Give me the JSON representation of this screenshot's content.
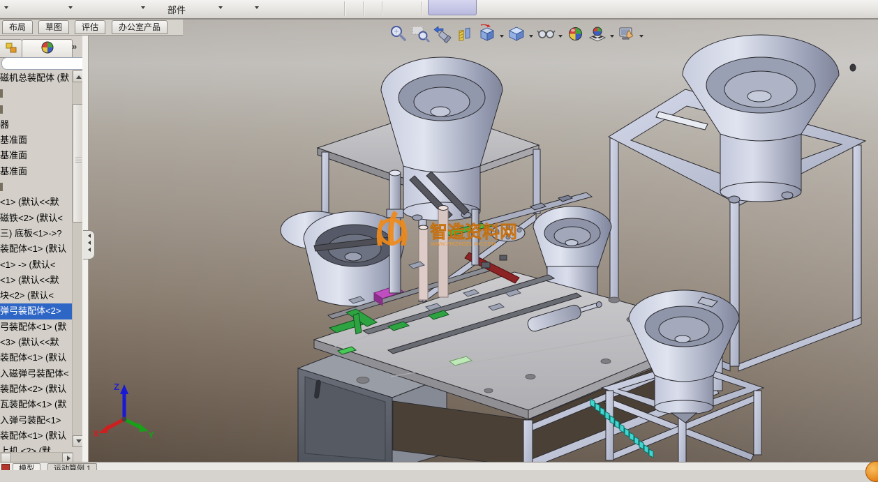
{
  "app": {
    "name": "SolidWorks assembly window (cropped)",
    "selection_color": "#2e66c6"
  },
  "top_toolbar": {
    "component_label": "部件",
    "dropdown_buttons": [
      "collapsed-dropdown-1",
      "collapsed-dropdown-2",
      "collapsed-dropdown-3",
      "component-dropdown-1",
      "component-dropdown-2"
    ],
    "active_button": "pressed-toolbar-button"
  },
  "command_tabs": [
    {
      "label": "布局"
    },
    {
      "label": "草图"
    },
    {
      "label": "评估"
    },
    {
      "label": "办公室产品"
    }
  ],
  "panel": {
    "tabs": [
      {
        "name": "feature-manager-tab"
      },
      {
        "name": "display-manager-tab"
      }
    ],
    "overflow_chevron": "»",
    "filter_value": "",
    "tree": [
      {
        "label": "磁机总装配体 (默",
        "selected": false
      },
      {
        "label": "",
        "selected": false
      },
      {
        "label": "",
        "selected": false
      },
      {
        "label": "器",
        "selected": false
      },
      {
        "label": "基准面",
        "selected": false
      },
      {
        "label": "基准面",
        "selected": false
      },
      {
        "label": "基准面",
        "selected": false
      },
      {
        "label": "",
        "selected": false
      },
      {
        "label": "<1> (默认<<默",
        "selected": false
      },
      {
        "label": "磁铁<2> (默认<",
        "selected": false
      },
      {
        "label": "三) 底板<1>->?",
        "selected": false
      },
      {
        "label": "装配体<1> (默认",
        "selected": false
      },
      {
        "label": "<1> -> (默认<",
        "selected": false
      },
      {
        "label": "<1> (默认<<默",
        "selected": false
      },
      {
        "label": "块<2> (默认<",
        "selected": false
      },
      {
        "label": "弹弓装配体<2>",
        "selected": true
      },
      {
        "label": "弓装配体<1> (默",
        "selected": false
      },
      {
        "label": "<3> (默认<<默",
        "selected": false
      },
      {
        "label": "装配体<1> (默认",
        "selected": false
      },
      {
        "label": "入磁弹弓装配体<",
        "selected": false
      },
      {
        "label": "装配体<2> (默认",
        "selected": false
      },
      {
        "label": "瓦装配体<1> (默",
        "selected": false
      },
      {
        "label": "入弹弓装配<1>",
        "selected": false
      },
      {
        "label": "装配体<1> (默认",
        "selected": false
      },
      {
        "label": "上机 <2> (默",
        "selected": false
      }
    ]
  },
  "hud_toolbar": {
    "icons": [
      {
        "name": "zoom-to-fit",
        "has_dropdown": false
      },
      {
        "name": "zoom-to-area",
        "has_dropdown": false
      },
      {
        "name": "previous-view",
        "has_dropdown": false
      },
      {
        "name": "section-view",
        "has_dropdown": false
      },
      {
        "name": "view-orientation",
        "has_dropdown": true
      },
      {
        "name": "display-style",
        "has_dropdown": true
      },
      {
        "name": "hide-show-items",
        "has_dropdown": true
      },
      {
        "name": "edit-appearance",
        "has_dropdown": false
      },
      {
        "name": "apply-scene",
        "has_dropdown": true
      },
      {
        "name": "view-settings",
        "has_dropdown": true
      }
    ]
  },
  "viewport": {
    "watermark": {
      "title": "智造资料网",
      "subtext": "WWW.ZHIZAOZILIAO.COM",
      "color": "#ee8816"
    },
    "triad": {
      "x_label": "X",
      "y_label": "Y",
      "z_label": "Z",
      "x_color": "#cc2020",
      "y_color": "#18a018",
      "z_color": "#1818d8"
    },
    "scene_objects": [
      {
        "id": "bowl-feeder-stand-top-center",
        "desc": "vibratory bowl feeder on frame table"
      },
      {
        "id": "bowl-feeder-frame-top-right",
        "desc": "vibratory bowl feeder on open frame stand"
      },
      {
        "id": "bowl-feeder-mid-right",
        "desc": "small vibratory bowl feeder"
      },
      {
        "id": "bowl-feeder-bottom-right",
        "desc": "vibratory bowl feeder on small braced stand"
      },
      {
        "id": "dual-bowls-left",
        "desc": "two overlapping feeder bowls beside main table"
      },
      {
        "id": "main-assembly-table",
        "desc": "assembly machine table with cabinet, rails, grippers, cylinders"
      },
      {
        "id": "parts-chain",
        "desc": "chain of teal parts leaving the table"
      }
    ]
  },
  "bottom_tabs": [
    {
      "label": "模型",
      "active": true
    },
    {
      "label": "运动算例 1",
      "active": false
    }
  ],
  "colors": {
    "viewport_gradient_top": "#c0bdb9",
    "viewport_gradient_bottom": "#5c4f43",
    "steel_light": "#d6dae8",
    "steel_dark": "#8f94a8",
    "watermark_orange": "#ee8816"
  }
}
